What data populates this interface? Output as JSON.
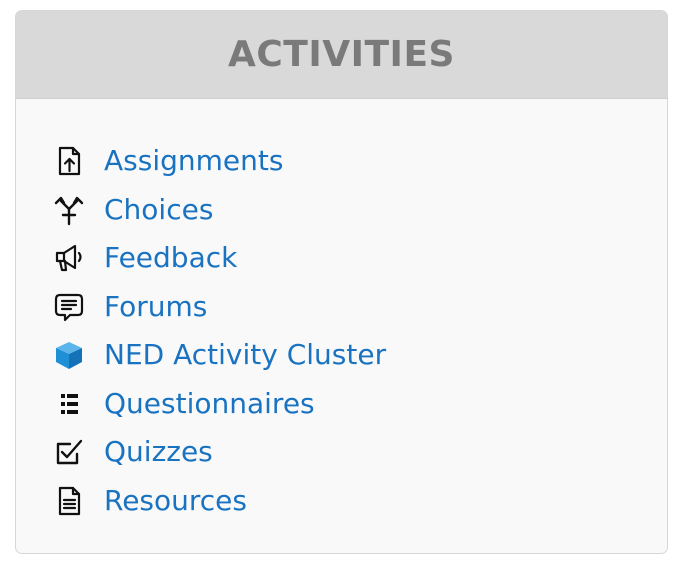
{
  "block": {
    "title": "ACTIVITIES",
    "accent_color": "#1a73c0",
    "items": [
      {
        "label": "Assignments",
        "icon": "assignment-upload-icon"
      },
      {
        "label": "Choices",
        "icon": "choice-signpost-icon"
      },
      {
        "label": "Feedback",
        "icon": "feedback-megaphone-icon"
      },
      {
        "label": "Forums",
        "icon": "forum-speech-bubble-icon"
      },
      {
        "label": "NED Activity Cluster",
        "icon": "activity-cluster-cube-icon"
      },
      {
        "label": "Questionnaires",
        "icon": "questionnaire-list-icon"
      },
      {
        "label": "Quizzes",
        "icon": "quiz-checkbox-icon"
      },
      {
        "label": "Resources",
        "icon": "resource-document-icon"
      }
    ]
  }
}
